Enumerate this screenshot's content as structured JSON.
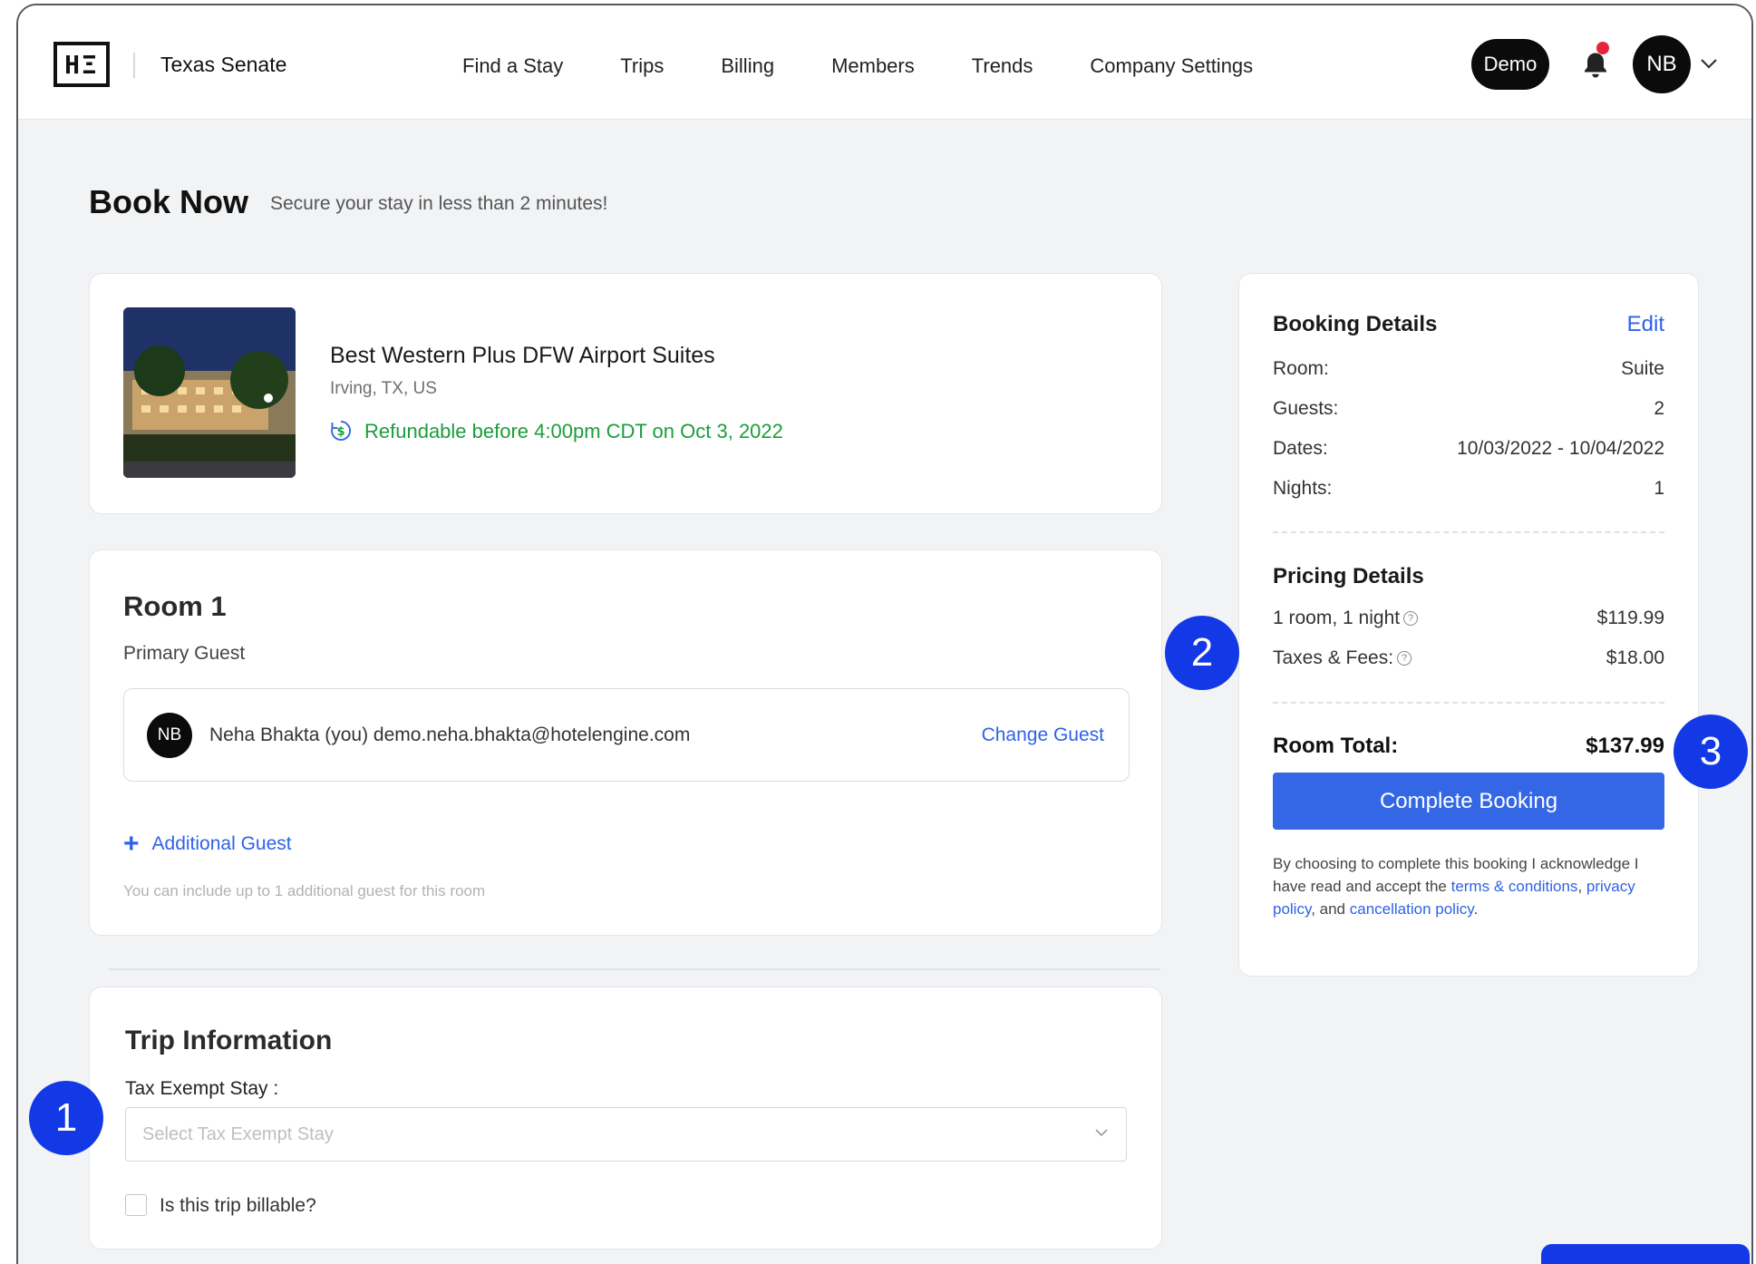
{
  "header": {
    "org_name": "Texas Senate",
    "logo_text": "HΞ",
    "nav": [
      "Find a Stay",
      "Trips",
      "Billing",
      "Members",
      "Trends",
      "Company Settings"
    ],
    "demo_label": "Demo",
    "user_initials": "NB"
  },
  "page": {
    "title": "Book Now",
    "subtitle": "Secure your stay in less than 2 minutes!"
  },
  "hotel": {
    "name": "Best Western Plus DFW Airport Suites",
    "location": "Irving, TX, US",
    "refund_text": "Refundable before 4:00pm CDT on Oct 3, 2022"
  },
  "room": {
    "title": "Room 1",
    "primary_guest_label": "Primary Guest",
    "guest_initials": "NB",
    "guest_text": "Neha Bhakta (you) demo.neha.bhakta@hotelengine.com",
    "change_guest": "Change Guest",
    "additional_guest": "Additional Guest",
    "additional_hint": "You can include up to 1 additional guest for this room"
  },
  "trip": {
    "title": "Trip Information",
    "tax_label": "Tax Exempt Stay :",
    "tax_placeholder": "Select Tax Exempt Stay",
    "billable_label": "Is this trip billable?",
    "billable_checked": false
  },
  "booking": {
    "heading": "Booking Details",
    "edit": "Edit",
    "rows": [
      {
        "label": "Room:",
        "value": "Suite"
      },
      {
        "label": "Guests:",
        "value": "2"
      },
      {
        "label": "Dates:",
        "value": "10/03/2022 - 10/04/2022"
      },
      {
        "label": "Nights:",
        "value": "1"
      }
    ],
    "pricing_heading": "Pricing Details",
    "pricing": [
      {
        "label": "1 room, 1 night",
        "value": "$119.99"
      },
      {
        "label": "Taxes & Fees:",
        "value": "$18.00"
      }
    ],
    "total_label": "Room Total:",
    "total_value": "$137.99",
    "complete_button": "Complete Booking",
    "legal_prefix": "By choosing to complete this booking I acknowledge I have read and accept the ",
    "terms_link": "terms & conditions",
    "comma": ", ",
    "privacy_link": "privacy policy",
    "and_text": ", and ",
    "cancel_link": "cancellation policy",
    "period": "."
  },
  "markers": [
    "1",
    "2",
    "3"
  ],
  "colors": {
    "accent": "#3467e6",
    "link": "#2f62e8",
    "refund_green": "#1a9e3b",
    "marker_blue": "#1339e6"
  }
}
